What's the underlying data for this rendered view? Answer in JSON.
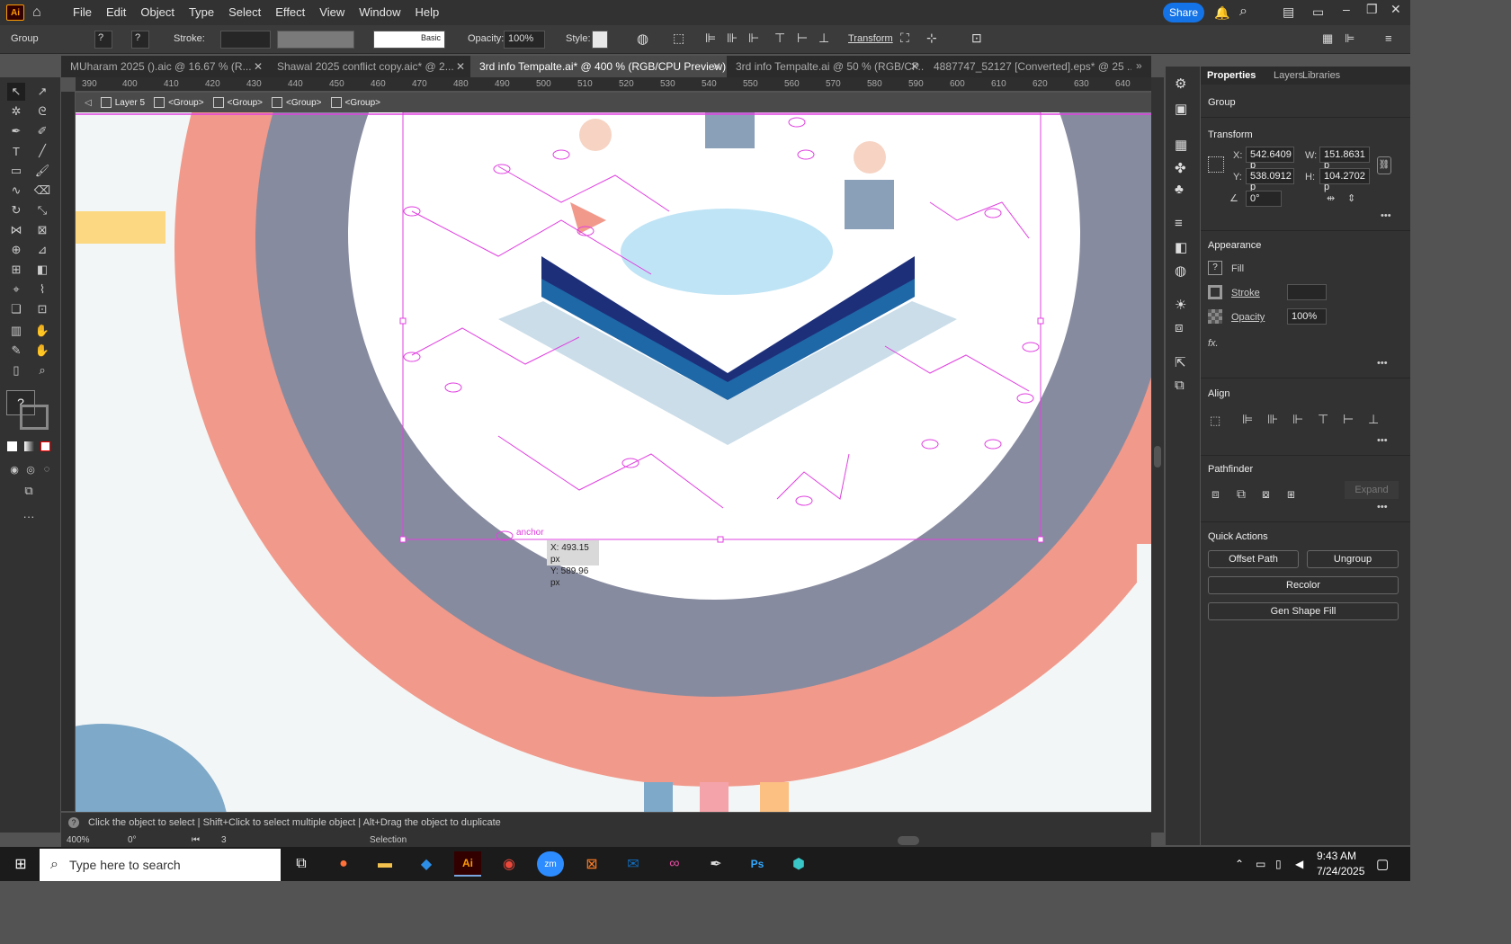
{
  "app": {
    "logo": "Ai",
    "share_label": "Share"
  },
  "menu": [
    "File",
    "Edit",
    "Object",
    "Type",
    "Select",
    "Effect",
    "View",
    "Window",
    "Help"
  ],
  "control_bar": {
    "selection_label": "Group",
    "stroke_label": "Stroke:",
    "stroke_profile": "Basic",
    "opacity_label": "Opacity:",
    "opacity_value": "100%",
    "style_label": "Style:",
    "transform_label": "Transform"
  },
  "tabs": [
    {
      "label": "MUharam 2025 ().aic @ 16.67 % (R..."
    },
    {
      "label": "Shawal 2025 conflict copy.aic* @ 2..."
    },
    {
      "label": "3rd info Tempalte.ai* @ 400 % (RGB/CPU Preview)"
    },
    {
      "label": "3rd info Tempalte.ai @ 50 % (RGB/CP..."
    },
    {
      "label": "4887747_52127 [Converted].eps* @ 25 ..."
    }
  ],
  "ruler_ticks": [
    "390",
    "400",
    "410",
    "420",
    "430",
    "440",
    "450",
    "460",
    "470",
    "480",
    "490",
    "500",
    "510",
    "520",
    "530",
    "540",
    "550",
    "560",
    "570",
    "580",
    "590",
    "600",
    "610",
    "620",
    "630",
    "640"
  ],
  "breadcrumbs": [
    "Layer 5",
    "<Group>",
    "<Group>",
    "<Group>",
    "<Group>"
  ],
  "canvas": {
    "anchor_label": "anchor",
    "tooltip_x": "X: 493.15 px",
    "tooltip_y": "Y: 589.96 px"
  },
  "status": {
    "hint": "Click the object to select  |  Shift+Click to select multiple object  |  Alt+Drag the object to duplicate",
    "zoom": "400%",
    "rotation": "0°",
    "artboard": "3",
    "tool": "Selection"
  },
  "panel": {
    "tabs": [
      "Properties",
      "Layers",
      "Libraries"
    ],
    "selection": "Group",
    "transform": {
      "title": "Transform",
      "x_label": "X:",
      "x": "542.6409 p",
      "y_label": "Y:",
      "y": "538.0912 p",
      "w_label": "W:",
      "w": "151.8631 p",
      "h_label": "H:",
      "h": "104.2702 p",
      "angle": "0°"
    },
    "appearance": {
      "title": "Appearance",
      "fill_label": "Fill",
      "stroke_label": "Stroke",
      "opacity_label": "Opacity",
      "opacity_value": "100%",
      "fx": "fx."
    },
    "align": {
      "title": "Align"
    },
    "pathfinder": {
      "title": "Pathfinder",
      "expand": "Expand"
    },
    "quick_actions": {
      "title": "Quick Actions",
      "offset_path": "Offset Path",
      "ungroup": "Ungroup",
      "recolor": "Recolor",
      "gen_shape_fill": "Gen Shape Fill"
    }
  },
  "taskbar": {
    "search_placeholder": "Type here to search",
    "time": "9:43 AM",
    "date": "7/24/2025"
  },
  "colors": {
    "accent": "#1473e6",
    "salmon": "#f1998b",
    "slate": "#878b9f",
    "selection": "#e040e0"
  }
}
